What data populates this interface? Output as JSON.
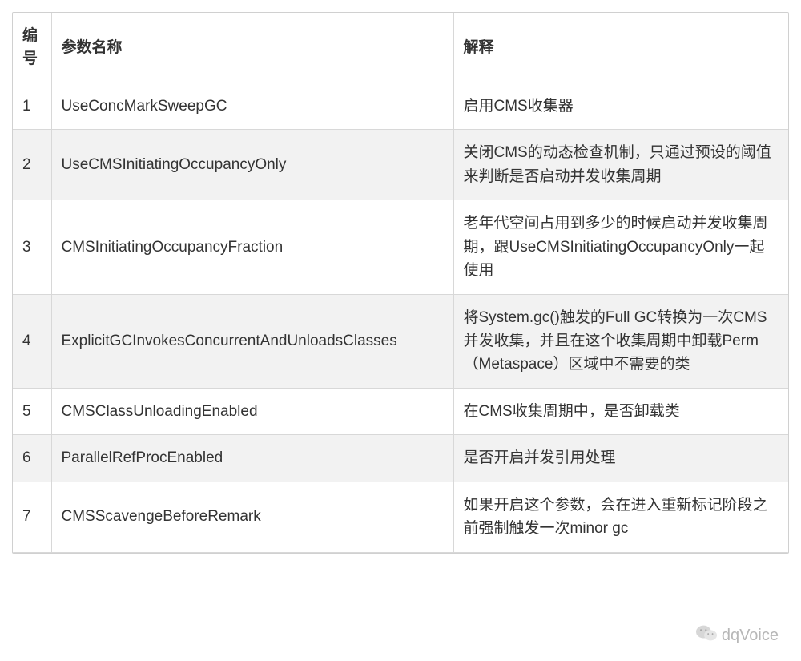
{
  "table": {
    "headers": {
      "index": "编号",
      "name": "参数名称",
      "desc": "解释"
    },
    "rows": [
      {
        "index": "1",
        "name": "UseConcMarkSweepGC",
        "desc": "启用CMS收集器"
      },
      {
        "index": "2",
        "name": "UseCMSInitiatingOccupancyOnly",
        "desc": "关闭CMS的动态检查机制，只通过预设的阈值来判断是否启动并发收集周期"
      },
      {
        "index": "3",
        "name": "CMSInitiatingOccupancyFraction",
        "desc": "老年代空间占用到多少的时候启动并发收集周期，跟UseCMSInitiatingOccupancyOnly一起使用"
      },
      {
        "index": "4",
        "name": "ExplicitGCInvokesConcurrentAndUnloadsClasses",
        "desc": "将System.gc()触发的Full GC转换为一次CMS并发收集，并且在这个收集周期中卸载Perm（Metaspace）区域中不需要的类"
      },
      {
        "index": "5",
        "name": "CMSClassUnloadingEnabled",
        "desc": "在CMS收集周期中，是否卸载类"
      },
      {
        "index": "6",
        "name": "ParallelRefProcEnabled",
        "desc": "是否开启并发引用处理"
      },
      {
        "index": "7",
        "name": "CMSScavengeBeforeRemark",
        "desc": "如果开启这个参数，会在进入重新标记阶段之前强制触发一次minor gc"
      }
    ]
  },
  "watermark": {
    "label": "dqVoice"
  }
}
